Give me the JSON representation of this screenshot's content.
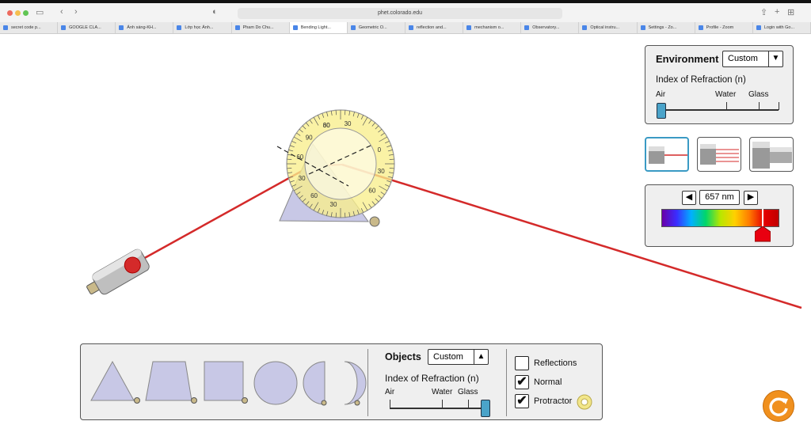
{
  "browser": {
    "url": "phet.colorado.edu",
    "tabs": [
      {
        "label": "secret code p..."
      },
      {
        "label": "GOOGLE CLA..."
      },
      {
        "label": "Ánh sáng-KH..."
      },
      {
        "label": "Lớp học Ánh..."
      },
      {
        "label": "Pham Do Chu..."
      },
      {
        "label": "Bending Light..."
      },
      {
        "label": "Geometric O..."
      },
      {
        "label": "reflection and..."
      },
      {
        "label": "mechanism o..."
      },
      {
        "label": "Observatory..."
      },
      {
        "label": "Optical instru..."
      },
      {
        "label": "Settings - Zo..."
      },
      {
        "label": "Profile - Zoom"
      },
      {
        "label": "Login with Go..."
      }
    ],
    "active_tab_index": 5
  },
  "environment": {
    "title": "Environment",
    "select_value": "Custom",
    "index_label": "Index of Refraction (n)",
    "ticks": {
      "air": "Air",
      "water": "Water",
      "glass": "Glass"
    },
    "slider_fraction": 0.0
  },
  "wavelength": {
    "value": "657 nm",
    "slider_fraction": 0.87
  },
  "objects": {
    "title": "Objects",
    "select_value": "Custom",
    "index_label": "Index of Refraction (n)",
    "ticks": {
      "air": "Air",
      "water": "Water",
      "glass": "Glass"
    },
    "slider_fraction": 1.0
  },
  "options": {
    "reflections": {
      "label": "Reflections",
      "checked": false
    },
    "normal": {
      "label": "Normal",
      "checked": true
    },
    "protractor": {
      "label": "Protractor",
      "checked": true
    }
  },
  "protractor_labels": [
    "60",
    "30",
    "0",
    "30",
    "60",
    "30",
    "60",
    "30",
    "60",
    "90",
    "30"
  ],
  "colors": {
    "beam": "#d42a2a",
    "accent": "#f0901e",
    "panel": "#efefef",
    "shape_fill": "#c8c8e6"
  }
}
